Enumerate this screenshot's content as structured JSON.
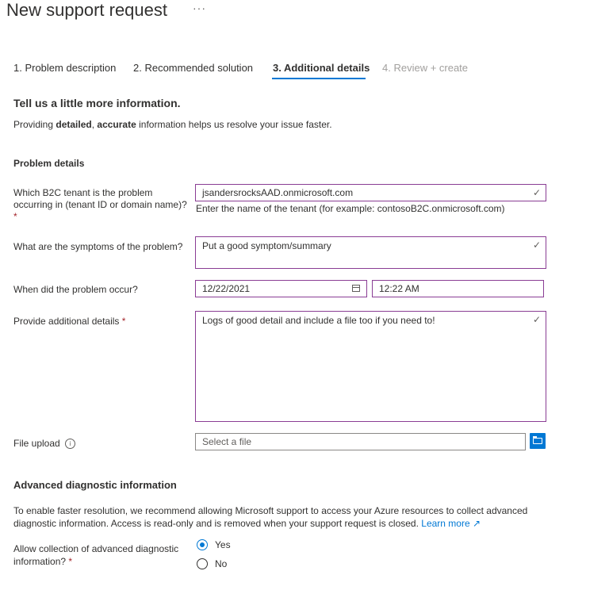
{
  "header": {
    "title": "New support request",
    "more_label": "···"
  },
  "tabs": [
    {
      "label": "1. Problem description"
    },
    {
      "label": "2. Recommended solution"
    },
    {
      "label": "3. Additional details"
    },
    {
      "label": "4. Review + create"
    }
  ],
  "intro": {
    "heading": "Tell us a little more information.",
    "desc_prefix": "Providing ",
    "desc_bold1": "detailed",
    "desc_sep": ", ",
    "desc_bold2": "accurate",
    "desc_suffix": " information helps us resolve your issue faster."
  },
  "problem_details": {
    "heading": "Problem details",
    "tenant": {
      "label_line1": "Which B2C tenant is the problem",
      "label_line2": "occurring in (tenant ID or domain name)?",
      "required_mark": "*",
      "value": "jsandersrocksAAD.onmicrosoft.com",
      "hint": "Enter the name of the tenant (for example: contosoB2C.onmicrosoft.com)"
    },
    "symptoms": {
      "label": "What are the symptoms of the problem?",
      "value": "Put a good symptom/summary"
    },
    "occurred": {
      "label": "When did the problem occur?",
      "date": "12/22/2021",
      "time": "12:22 AM"
    },
    "additional": {
      "label": "Provide additional details",
      "required_mark": "*",
      "value": "Logs of good detail and include a file too if you need to!"
    },
    "upload": {
      "label": "File upload",
      "placeholder": "Select a file"
    }
  },
  "advanced": {
    "heading": "Advanced diagnostic information",
    "desc_line1": "To enable faster resolution, we recommend allowing Microsoft support to access your Azure resources to collect advanced",
    "desc_line2": "diagnostic information. Access is read-only and is removed when your support request is closed.",
    "learn_more": "Learn more",
    "allow_label_line1": "Allow collection of advanced diagnostic",
    "allow_label_line2": "information?",
    "required_mark": "*",
    "options": [
      {
        "label": "Yes",
        "selected": true
      },
      {
        "label": "No",
        "selected": false
      }
    ]
  }
}
